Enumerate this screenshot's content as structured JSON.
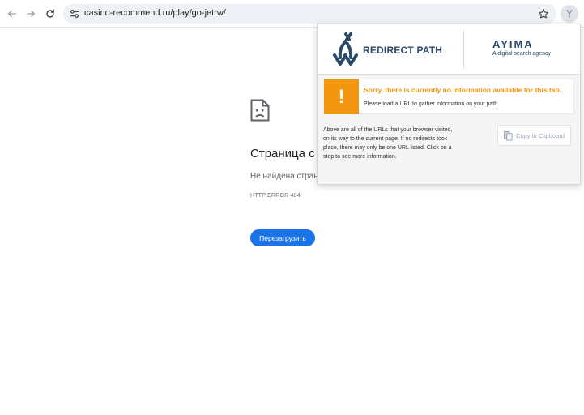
{
  "browser": {
    "url": "casino-recommend.ru/play/go-jetrw/"
  },
  "error_page": {
    "title": "Страница с",
    "subtitle": "Не найдена стран",
    "error_code": "HTTP ERROR 404",
    "reload_label": "Перезагрузить"
  },
  "extension_popup": {
    "brand": "REDIRECT PATH",
    "partner_logo": "AYIMA",
    "partner_tagline": "A digital search agency",
    "notice_title": "Sorry, there is currently no information available for this tab.",
    "notice_text": "Please load a URL to gather information on your path.",
    "description_lines": [
      "Above are all of the URLs that your browser visited,",
      "on its way to the current page. If no redirects took",
      "place, there may only be one URL listed. Click on a",
      "step to see more information."
    ],
    "copy_label": "Copy to Clipboard"
  },
  "colors": {
    "accent_blue": "#1a73e8",
    "warning_orange": "#f2960f",
    "brand_navy": "#2b4a6a"
  }
}
